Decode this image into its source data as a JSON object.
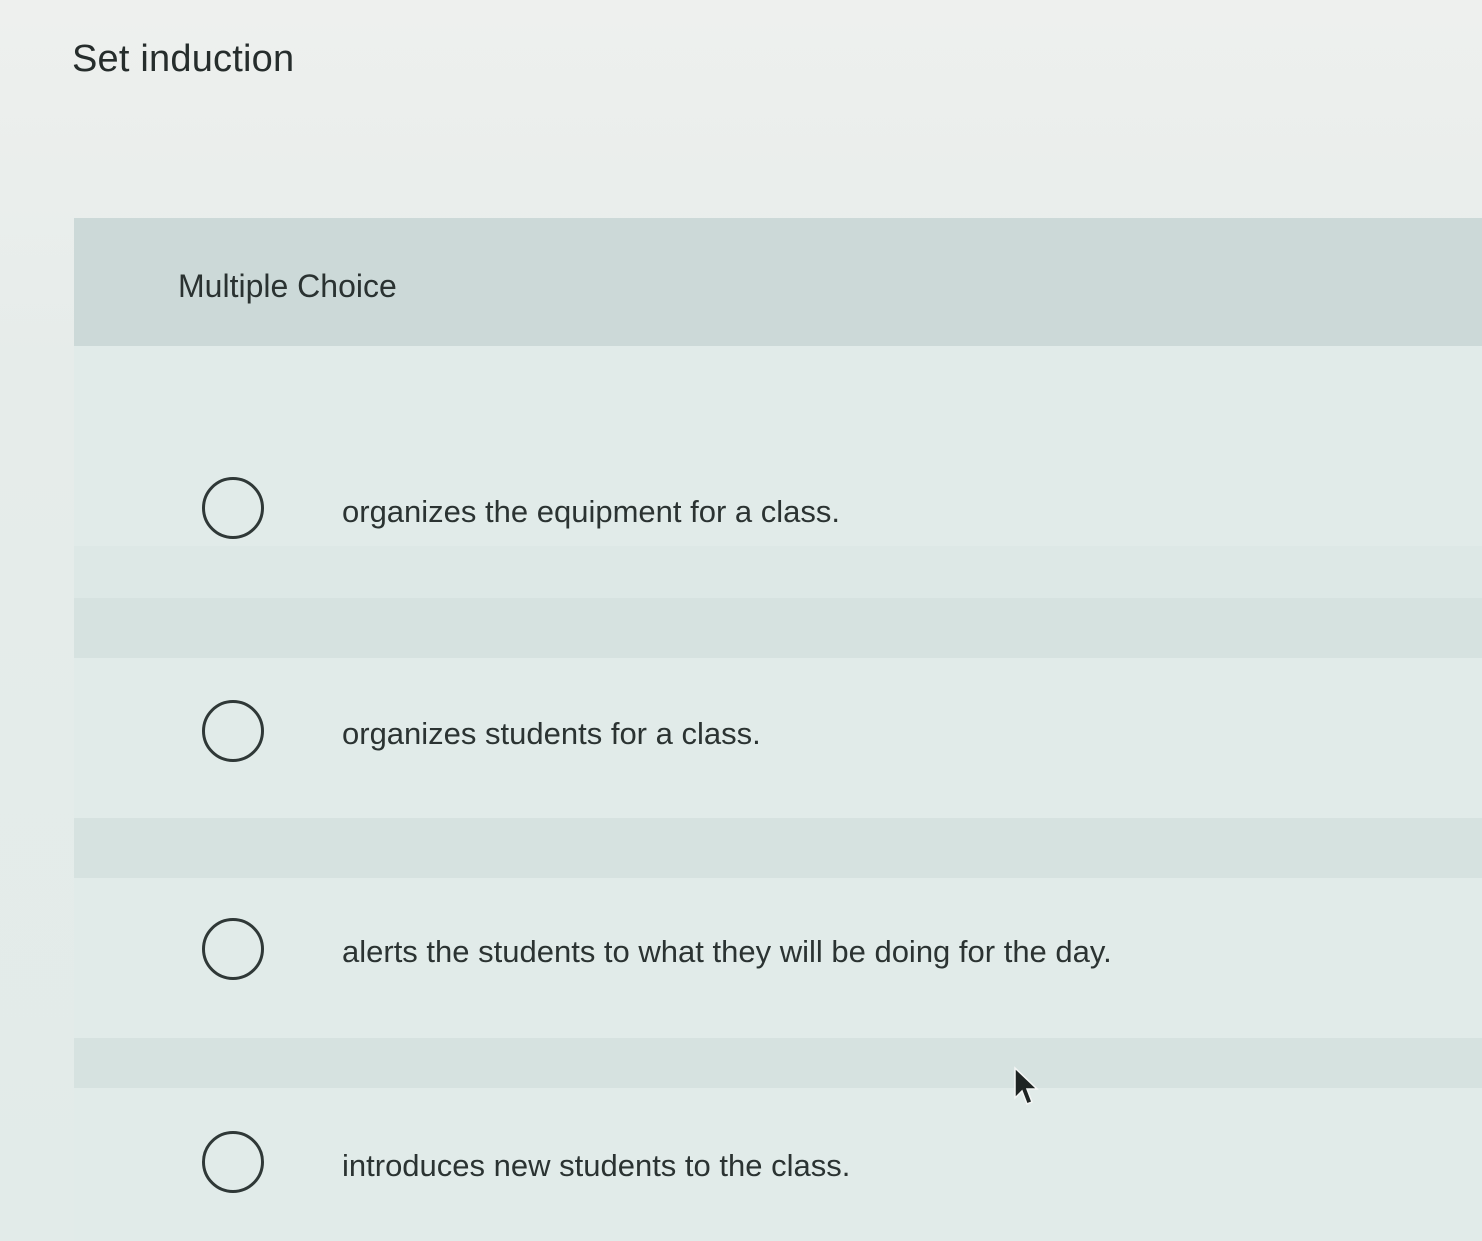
{
  "question": {
    "title": "Set induction"
  },
  "card": {
    "type_label": "Multiple Choice"
  },
  "options": [
    {
      "label": "organizes the equipment for a class."
    },
    {
      "label": "organizes students for a class."
    },
    {
      "label": "alerts the students to what they will be doing for the day."
    },
    {
      "label": "introduces new students to the class."
    }
  ],
  "icons": {
    "radio": "radio-unchecked-icon",
    "cursor": "mouse-pointer-icon"
  }
}
